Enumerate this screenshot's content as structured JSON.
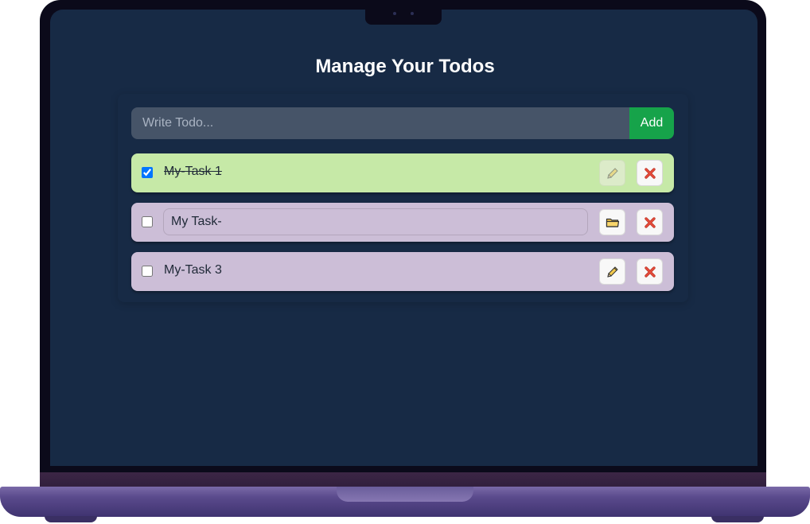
{
  "app": {
    "title": "Manage Your Todos"
  },
  "form": {
    "placeholder": "Write Todo...",
    "add_label": "Add"
  },
  "todos": [
    {
      "text": "My-Task 1",
      "completed": true,
      "editing": false
    },
    {
      "text": "My Task-",
      "completed": false,
      "editing": true
    },
    {
      "text": "My-Task 3",
      "completed": false,
      "editing": false
    }
  ],
  "colors": {
    "screen_bg": "#172a45",
    "completed_bg": "#c6e9a7",
    "pending_bg": "#ccbed7",
    "add_button": "#16a34a",
    "input_bg": "#465468"
  },
  "icons": {
    "edit": "pencil-icon",
    "save": "folder-icon",
    "delete": "cross-mark-icon"
  }
}
